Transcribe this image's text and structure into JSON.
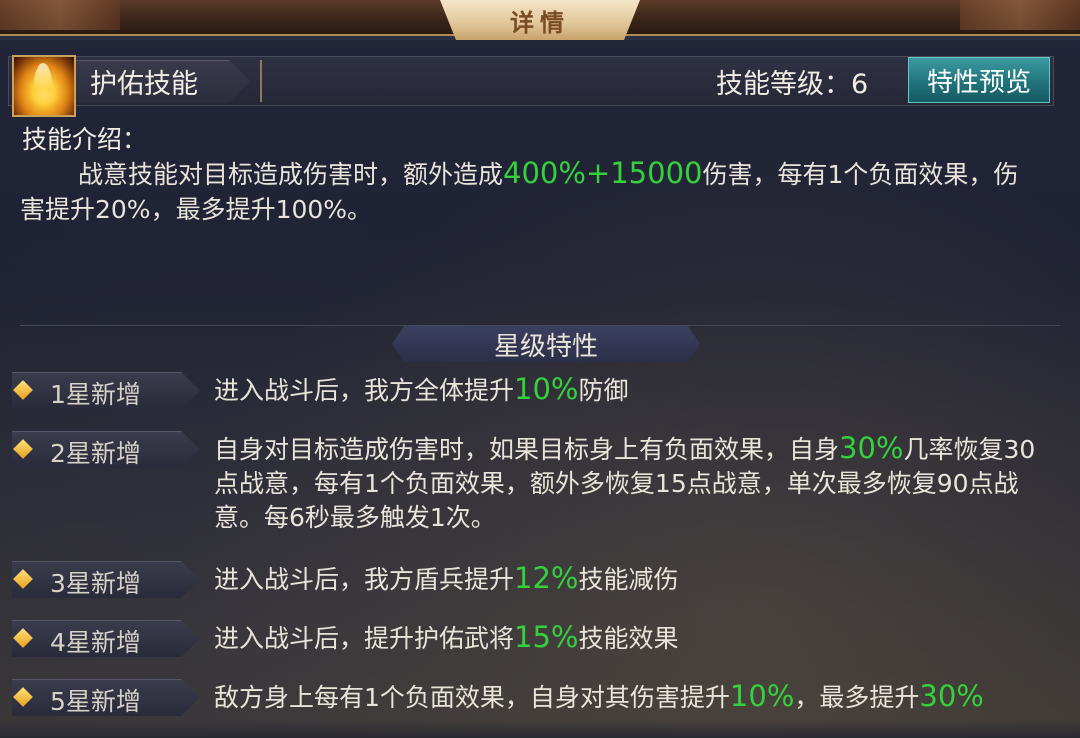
{
  "window": {
    "title": "详情"
  },
  "skill": {
    "name": "护佑技能",
    "level_label": "技能等级：6",
    "preview_button": "特性预览",
    "icon": "flame-skill-icon"
  },
  "intro": {
    "title": "技能介绍：",
    "text_before": "战意技能对目标造成伤害时，额外造成",
    "highlight": "400%+15000",
    "text_after": "伤害，每有1个负面效果，伤害提升20%，最多提升100%。"
  },
  "star_section": {
    "title": "星级特性",
    "rows": [
      {
        "label": "1星新增",
        "before": "进入战斗后，我方全体提升",
        "highlight": "10%",
        "after": "防御"
      },
      {
        "label": "2星新增",
        "before": "自身对目标造成伤害时，如果目标身上有负面效果，自身",
        "highlight": "30%",
        "after": "几率恢复30点战意，每有1个负面效果，额外多恢复15点战意，单次最多恢复90点战意。每6秒最多触发1次。"
      },
      {
        "label": "3星新增",
        "before": "进入战斗后，我方盾兵提升",
        "highlight": "12%",
        "after": "技能减伤"
      },
      {
        "label": "4星新增",
        "before": "进入战斗后，提升护佑武将",
        "highlight": "15%",
        "after": "技能效果"
      },
      {
        "label": "5星新增",
        "before": "敌方身上每有1个负面效果，自身对其伤害提升",
        "highlight": "10%",
        "after": "，最多提升",
        "highlight2": "30%"
      }
    ]
  },
  "colors": {
    "highlight": "#34d13c",
    "button": "#22747c",
    "title_plate": "#e2c99c"
  }
}
